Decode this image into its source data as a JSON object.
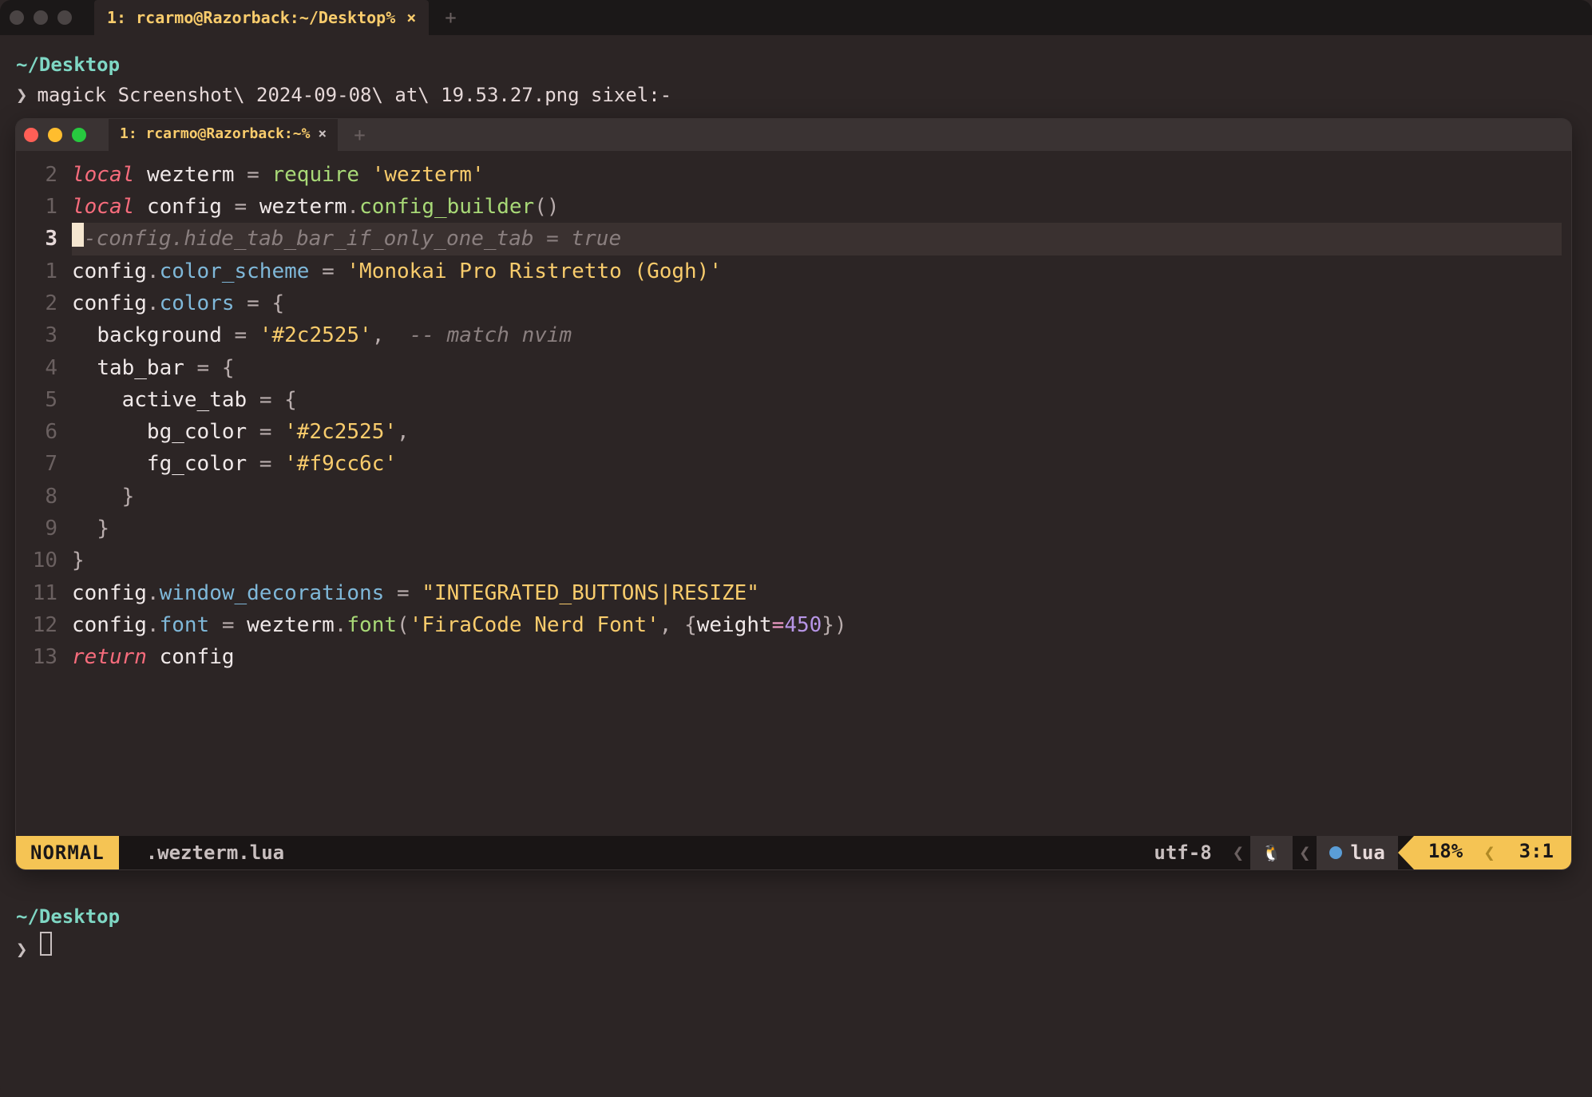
{
  "outer": {
    "tab_title": "1: rcarmo@Razorback:~/Desktop%",
    "prompt_path": "~/Desktop",
    "prompt_symbol": "❯",
    "command": "magick Screenshot\\ 2024-09-08\\ at\\ 19.53.27.png sixel:-",
    "prompt2_path": "~/Desktop",
    "prompt2_symbol": "❯"
  },
  "inner": {
    "tab_title": "1: rcarmo@Razorback:~%"
  },
  "code": {
    "gutters": [
      "2",
      "1",
      "3",
      "1",
      "2",
      "3",
      "4",
      "5",
      "6",
      "7",
      "8",
      "9",
      "10",
      "11",
      "12",
      "13"
    ],
    "current_index": 2,
    "l0": {
      "kw": "local",
      "sp": " ",
      "id": "wezterm",
      "eq": " = ",
      "fn": "require",
      "sp2": " ",
      "str": "'wezterm'"
    },
    "l1": {
      "kw": "local",
      "sp": " ",
      "id": "config",
      "eq": " = ",
      "obj": "wezterm",
      "dot": ".",
      "meth": "config_builder",
      "paren": "()"
    },
    "l2": {
      "comment": "-config.hide_tab_bar_if_only_one_tab = true"
    },
    "l3": {
      "obj": "config",
      "dot": ".",
      "prop": "color_scheme",
      "eq": " = ",
      "str": "'Monokai Pro Ristretto (Gogh)'"
    },
    "l4": {
      "obj": "config",
      "dot": ".",
      "prop": "colors",
      "eq": " = ",
      "brace": "{"
    },
    "l5": {
      "indent": "  ",
      "key": "background",
      "eq": " = ",
      "str": "'#2c2525'",
      "comma": ",",
      "sp": "  ",
      "comment": "-- match nvim"
    },
    "l6": {
      "indent": "  ",
      "key": "tab_bar",
      "eq": " = ",
      "brace": "{"
    },
    "l7": {
      "indent": "    ",
      "key": "active_tab",
      "eq": " = ",
      "brace": "{"
    },
    "l8": {
      "indent": "      ",
      "key": "bg_color",
      "eq": " = ",
      "str": "'#2c2525'",
      "comma": ","
    },
    "l9": {
      "indent": "      ",
      "key": "fg_color",
      "eq": " = ",
      "str": "'#f9cc6c'"
    },
    "l10": {
      "indent": "    ",
      "brace": "}"
    },
    "l11": {
      "indent": "  ",
      "brace": "}"
    },
    "l12": {
      "brace": "}"
    },
    "l13": {
      "obj": "config",
      "dot": ".",
      "prop": "window_decorations",
      "eq": " = ",
      "str": "\"INTEGRATED_BUTTONS|RESIZE\""
    },
    "l14": {
      "obj": "config",
      "dot": ".",
      "prop": "font",
      "eq": " = ",
      "obj2": "wezterm",
      "dot2": ".",
      "meth": "font",
      "open": "(",
      "str": "'FiraCode Nerd Font'",
      "comma": ", ",
      "brace": "{",
      "argk": "weight",
      "argop": "=",
      "argv": "450",
      "brace2": "}",
      "close": ")"
    },
    "l15": {
      "kw": "return",
      "sp": " ",
      "id": "config"
    }
  },
  "status": {
    "mode": "NORMAL",
    "filename": ".wezterm.lua",
    "encoding": "utf-8",
    "os_icon": "🐧",
    "lang": "lua",
    "percent": "18%",
    "position": "3:1"
  }
}
